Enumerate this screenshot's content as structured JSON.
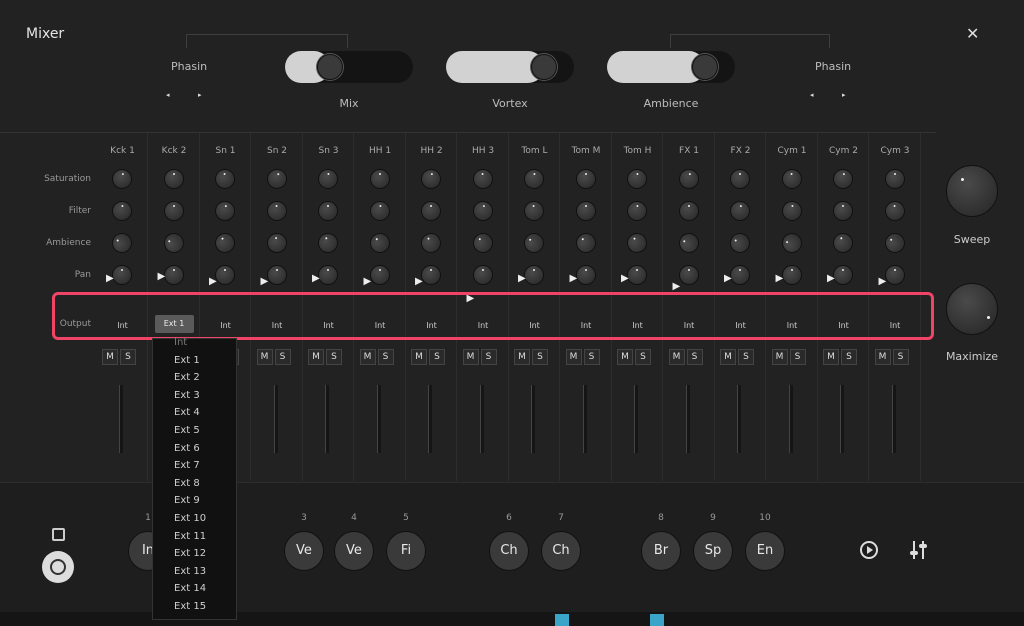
{
  "window": {
    "title": "Mixer",
    "close_icon": "✕"
  },
  "top": {
    "left_bus": {
      "name": "Phasin",
      "prev": "◂",
      "next": "▸"
    },
    "right_bus": {
      "name": "Phasin",
      "prev": "◂",
      "next": "▸"
    },
    "toggles": [
      {
        "label": "Mix",
        "level": 0.3
      },
      {
        "label": "Vortex",
        "level": 0.85
      },
      {
        "label": "Ambience",
        "level": 0.85
      }
    ]
  },
  "rows": {
    "saturation": "Saturation",
    "filter": "Filter",
    "ambience": "Ambience",
    "pan": "Pan",
    "output": "Output"
  },
  "channels": [
    {
      "name": "Kck 1",
      "output": "Int"
    },
    {
      "name": "Kck 2",
      "output": "Ext 1"
    },
    {
      "name": "Sn 1",
      "output": "Int"
    },
    {
      "name": "Sn 2",
      "output": "Int"
    },
    {
      "name": "Sn 3",
      "output": "Int"
    },
    {
      "name": "HH 1",
      "output": "Int"
    },
    {
      "name": "HH 2",
      "output": "Int"
    },
    {
      "name": "HH 3",
      "output": "Int"
    },
    {
      "name": "Tom L",
      "output": "Int"
    },
    {
      "name": "Tom M",
      "output": "Int"
    },
    {
      "name": "Tom H",
      "output": "Int"
    },
    {
      "name": "FX 1",
      "output": "Int"
    },
    {
      "name": "FX 2",
      "output": "Int"
    },
    {
      "name": "Cym 1",
      "output": "Int"
    },
    {
      "name": "Cym 2",
      "output": "Int"
    },
    {
      "name": "Cym 3",
      "output": "Int"
    }
  ],
  "mute_label": "M",
  "solo_label": "S",
  "macros": [
    {
      "label": "Sweep"
    },
    {
      "label": "Maximize"
    }
  ],
  "output_menu": {
    "items": [
      "Int",
      "Ext 1",
      "Ext 2",
      "Ext 3",
      "Ext 4",
      "Ext 5",
      "Ext 6",
      "Ext 7",
      "Ext 8",
      "Ext 9",
      "Ext 10",
      "Ext 11",
      "Ext 12",
      "Ext 13",
      "Ext 14",
      "Ext 15"
    ]
  },
  "pads": [
    {
      "num": "1",
      "label": "In"
    },
    {
      "num": "3",
      "label": "Ve"
    },
    {
      "num": "4",
      "label": "Ve"
    },
    {
      "num": "5",
      "label": "Fi"
    },
    {
      "num": "6",
      "label": "Ch"
    },
    {
      "num": "7",
      "label": "Ch"
    },
    {
      "num": "8",
      "label": "Br"
    },
    {
      "num": "9",
      "label": "Sp"
    },
    {
      "num": "10",
      "label": "En"
    }
  ],
  "icons": {
    "square": "square-icon",
    "record": "record-icon",
    "history": "history-icon",
    "settings": "sliders-icon"
  }
}
